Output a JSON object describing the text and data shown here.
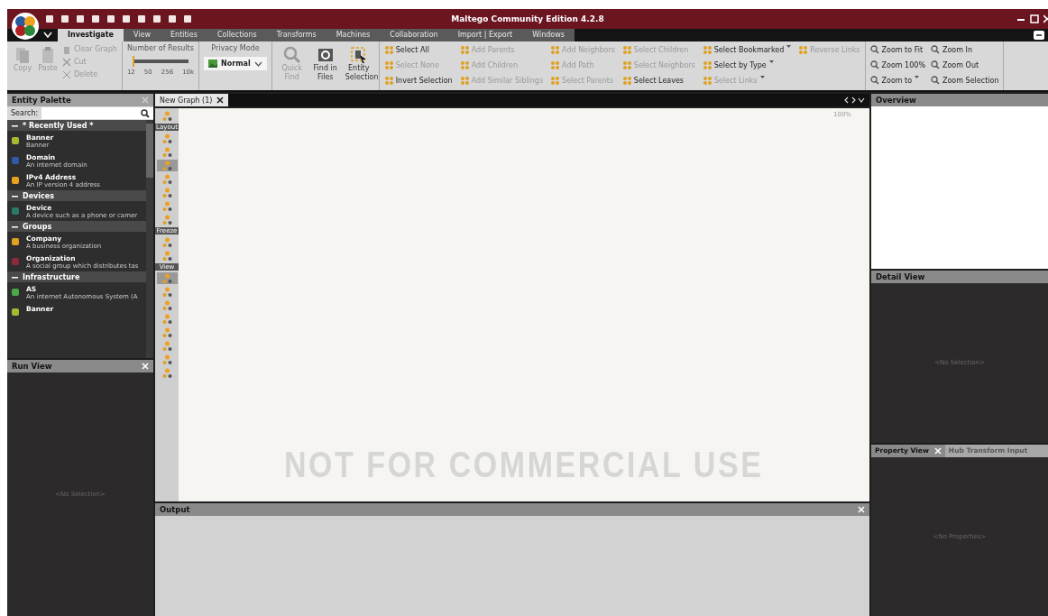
{
  "window": {
    "title": "Maltego Community Edition 4.2.8"
  },
  "tabs": [
    {
      "label": "Investigate",
      "selected": true
    },
    {
      "label": "View",
      "selected": false
    },
    {
      "label": "Entities",
      "selected": false
    },
    {
      "label": "Collections",
      "selected": false
    },
    {
      "label": "Transforms",
      "selected": false
    },
    {
      "label": "Machines",
      "selected": false
    },
    {
      "label": "Collaboration",
      "selected": false
    },
    {
      "label": "Import | Export",
      "selected": false
    },
    {
      "label": "Windows",
      "selected": false
    }
  ],
  "ribbon": {
    "clipboard": [
      {
        "label": "Copy",
        "disabled": true
      },
      {
        "label": "Paste",
        "disabled": true
      }
    ],
    "edit": [
      {
        "label": "Clear Graph",
        "disabled": true
      },
      {
        "label": "Cut",
        "disabled": true
      },
      {
        "label": "Delete",
        "disabled": true
      }
    ],
    "results": {
      "title": "Number of Results",
      "level": 0,
      "ticks": [
        "12",
        "50",
        "256",
        "10k"
      ]
    },
    "privacy": {
      "title": "Privacy Mode",
      "value": "Normal"
    },
    "find": [
      {
        "label": "Quick Find",
        "disabled": true
      },
      {
        "label": "Find in Files",
        "disabled": false
      }
    ],
    "entity_selection": {
      "label": "Entity Selection"
    },
    "rows": [
      [
        {
          "label": "Select All",
          "disabled": false,
          "dropdown": false
        },
        {
          "label": "Add Parents",
          "disabled": true,
          "dropdown": false
        },
        {
          "label": "Add Neighbors",
          "disabled": true,
          "dropdown": false
        },
        {
          "label": "Select Children",
          "disabled": true,
          "dropdown": false
        },
        {
          "label": "Select Bookmarked",
          "disabled": false,
          "dropdown": true
        },
        {
          "label": "Reverse Links",
          "disabled": true,
          "dropdown": false
        }
      ],
      [
        {
          "label": "Select None",
          "disabled": true,
          "dropdown": false
        },
        {
          "label": "Add Children",
          "disabled": true,
          "dropdown": false
        },
        {
          "label": "Add Path",
          "disabled": true,
          "dropdown": false
        },
        {
          "label": "Select Neighbors",
          "disabled": true,
          "dropdown": false
        },
        {
          "label": "Select by Type",
          "disabled": false,
          "dropdown": true
        }
      ],
      [
        {
          "label": "Invert Selection",
          "disabled": false,
          "dropdown": false
        },
        {
          "label": "Add Similar Siblings",
          "disabled": true,
          "dropdown": false
        },
        {
          "label": "Select Parents",
          "disabled": true,
          "dropdown": false
        },
        {
          "label": "Select Leaves",
          "disabled": false,
          "dropdown": false
        },
        {
          "label": "Select Links",
          "disabled": true,
          "dropdown": true
        }
      ]
    ],
    "zoom": [
      [
        {
          "label": "Zoom to Fit",
          "dropdown": false
        },
        {
          "label": "Zoom In",
          "dropdown": false
        }
      ],
      [
        {
          "label": "Zoom 100%",
          "dropdown": false
        },
        {
          "label": "Zoom Out",
          "dropdown": false
        }
      ],
      [
        {
          "label": "Zoom to",
          "dropdown": true
        },
        {
          "label": "Zoom Selection",
          "dropdown": false
        }
      ]
    ]
  },
  "entity_palette": {
    "title": "Entity Palette",
    "search_label": "Search:",
    "groups": [
      {
        "name": "* Recently Used *",
        "expanded": true,
        "children": [
          {
            "name": "Banner",
            "description": "Banner",
            "color": "#a8b832"
          },
          {
            "name": "Domain",
            "description": "An internet domain",
            "color": "#2f5aa8"
          },
          {
            "name": "IPv4 Address",
            "description": "An IP version 4 address",
            "color": "#e8a020"
          }
        ]
      },
      {
        "name": "Devices",
        "expanded": true,
        "children": [
          {
            "name": "Device",
            "description": "A device such as a phone or camer",
            "color": "#2a7a6a"
          }
        ]
      },
      {
        "name": "Groups",
        "expanded": true,
        "children": [
          {
            "name": "Company",
            "description": "A business organization",
            "color": "#e0a020"
          },
          {
            "name": "Organization",
            "description": "A social group which distributes tas",
            "color": "#8a2a3a"
          }
        ]
      },
      {
        "name": "Infrastructure",
        "expanded": true,
        "children": [
          {
            "name": "AS",
            "description": "An internet Autonomous System (A",
            "color": "#4aa84a"
          },
          {
            "name": "Banner",
            "color": "#a8b832"
          }
        ]
      }
    ]
  },
  "run_view": {
    "title": "Run View",
    "message": "<No Selection>"
  },
  "graph": {
    "tab": {
      "label": "New Graph (1)",
      "selected": true
    },
    "zoom_reading": "100%",
    "notice": "NOT FOR COMMERCIAL USE",
    "toolbar": [
      {
        "kind": "tool",
        "selected": false
      },
      {
        "kind": "label",
        "text": "Layout"
      },
      {
        "kind": "tool",
        "selected": false
      },
      {
        "kind": "tool",
        "selected": false
      },
      {
        "kind": "tool",
        "selected": true
      },
      {
        "kind": "tool",
        "selected": false
      },
      {
        "kind": "tool",
        "selected": false
      },
      {
        "kind": "tool",
        "selected": false
      },
      {
        "kind": "tool",
        "selected": false
      },
      {
        "kind": "label",
        "text": "Freeze"
      },
      {
        "kind": "tool",
        "selected": false
      },
      {
        "kind": "tool",
        "selected": false
      },
      {
        "kind": "label",
        "text": "View"
      },
      {
        "kind": "tool",
        "selected": true
      },
      {
        "kind": "tool",
        "selected": false
      },
      {
        "kind": "tool",
        "selected": false
      },
      {
        "kind": "tool",
        "selected": false
      },
      {
        "kind": "tool",
        "selected": false
      },
      {
        "kind": "tool",
        "selected": false
      },
      {
        "kind": "tool",
        "selected": false
      },
      {
        "kind": "tool",
        "selected": false
      }
    ]
  },
  "output": {
    "title": "Output"
  },
  "overview": {
    "title": "Overview"
  },
  "detail_view": {
    "title": "Detail View",
    "message": "<No Selection>"
  },
  "property_view": {
    "tabs": [
      {
        "label": "Property View",
        "selected": true
      },
      {
        "label": "Hub Transform Input",
        "selected": false
      }
    ],
    "message": "<No Properties>"
  }
}
